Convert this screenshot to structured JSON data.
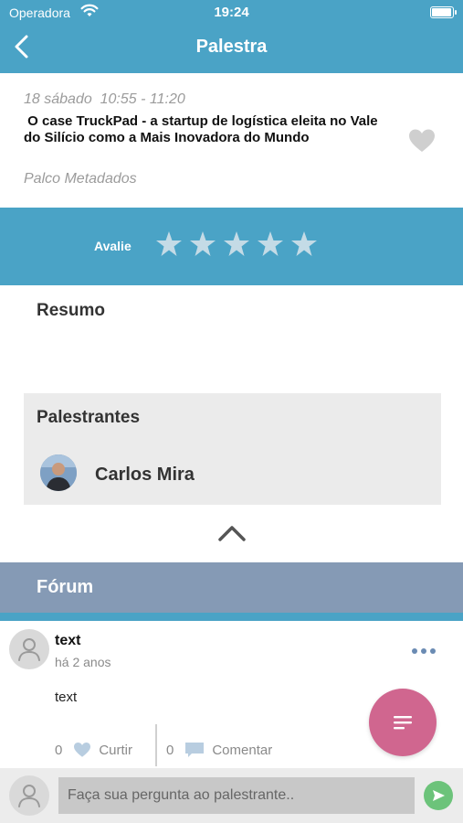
{
  "status_bar": {
    "carrier": "Operadora",
    "time": "19:24"
  },
  "nav": {
    "title": "Palestra"
  },
  "talk": {
    "datetime": "18 sábado  10:55 - 11:20",
    "title": " O case TruckPad - a startup de logística eleita no Vale do Silício como a Mais Inovadora do Mundo",
    "location": "Palco Metadados"
  },
  "rating": {
    "label": "Avalie",
    "max_stars": 5,
    "value": 0
  },
  "summary": {
    "heading": "Resumo"
  },
  "speakers": {
    "heading": "Palestrantes",
    "items": [
      {
        "name": "Carlos Mira"
      }
    ]
  },
  "forum": {
    "heading": "Fórum",
    "posts": [
      {
        "user": "text",
        "time": "há 2 anos",
        "body": "text",
        "likes": "0",
        "like_label": "Curtir",
        "comments": "0",
        "comment_label": "Comentar"
      }
    ]
  },
  "composer": {
    "placeholder": "Faça sua pergunta ao palestrante.."
  },
  "colors": {
    "primary": "#4aa3c6",
    "forum_header": "#859ab5",
    "fab": "#d0668f",
    "send": "#6cc37a"
  }
}
